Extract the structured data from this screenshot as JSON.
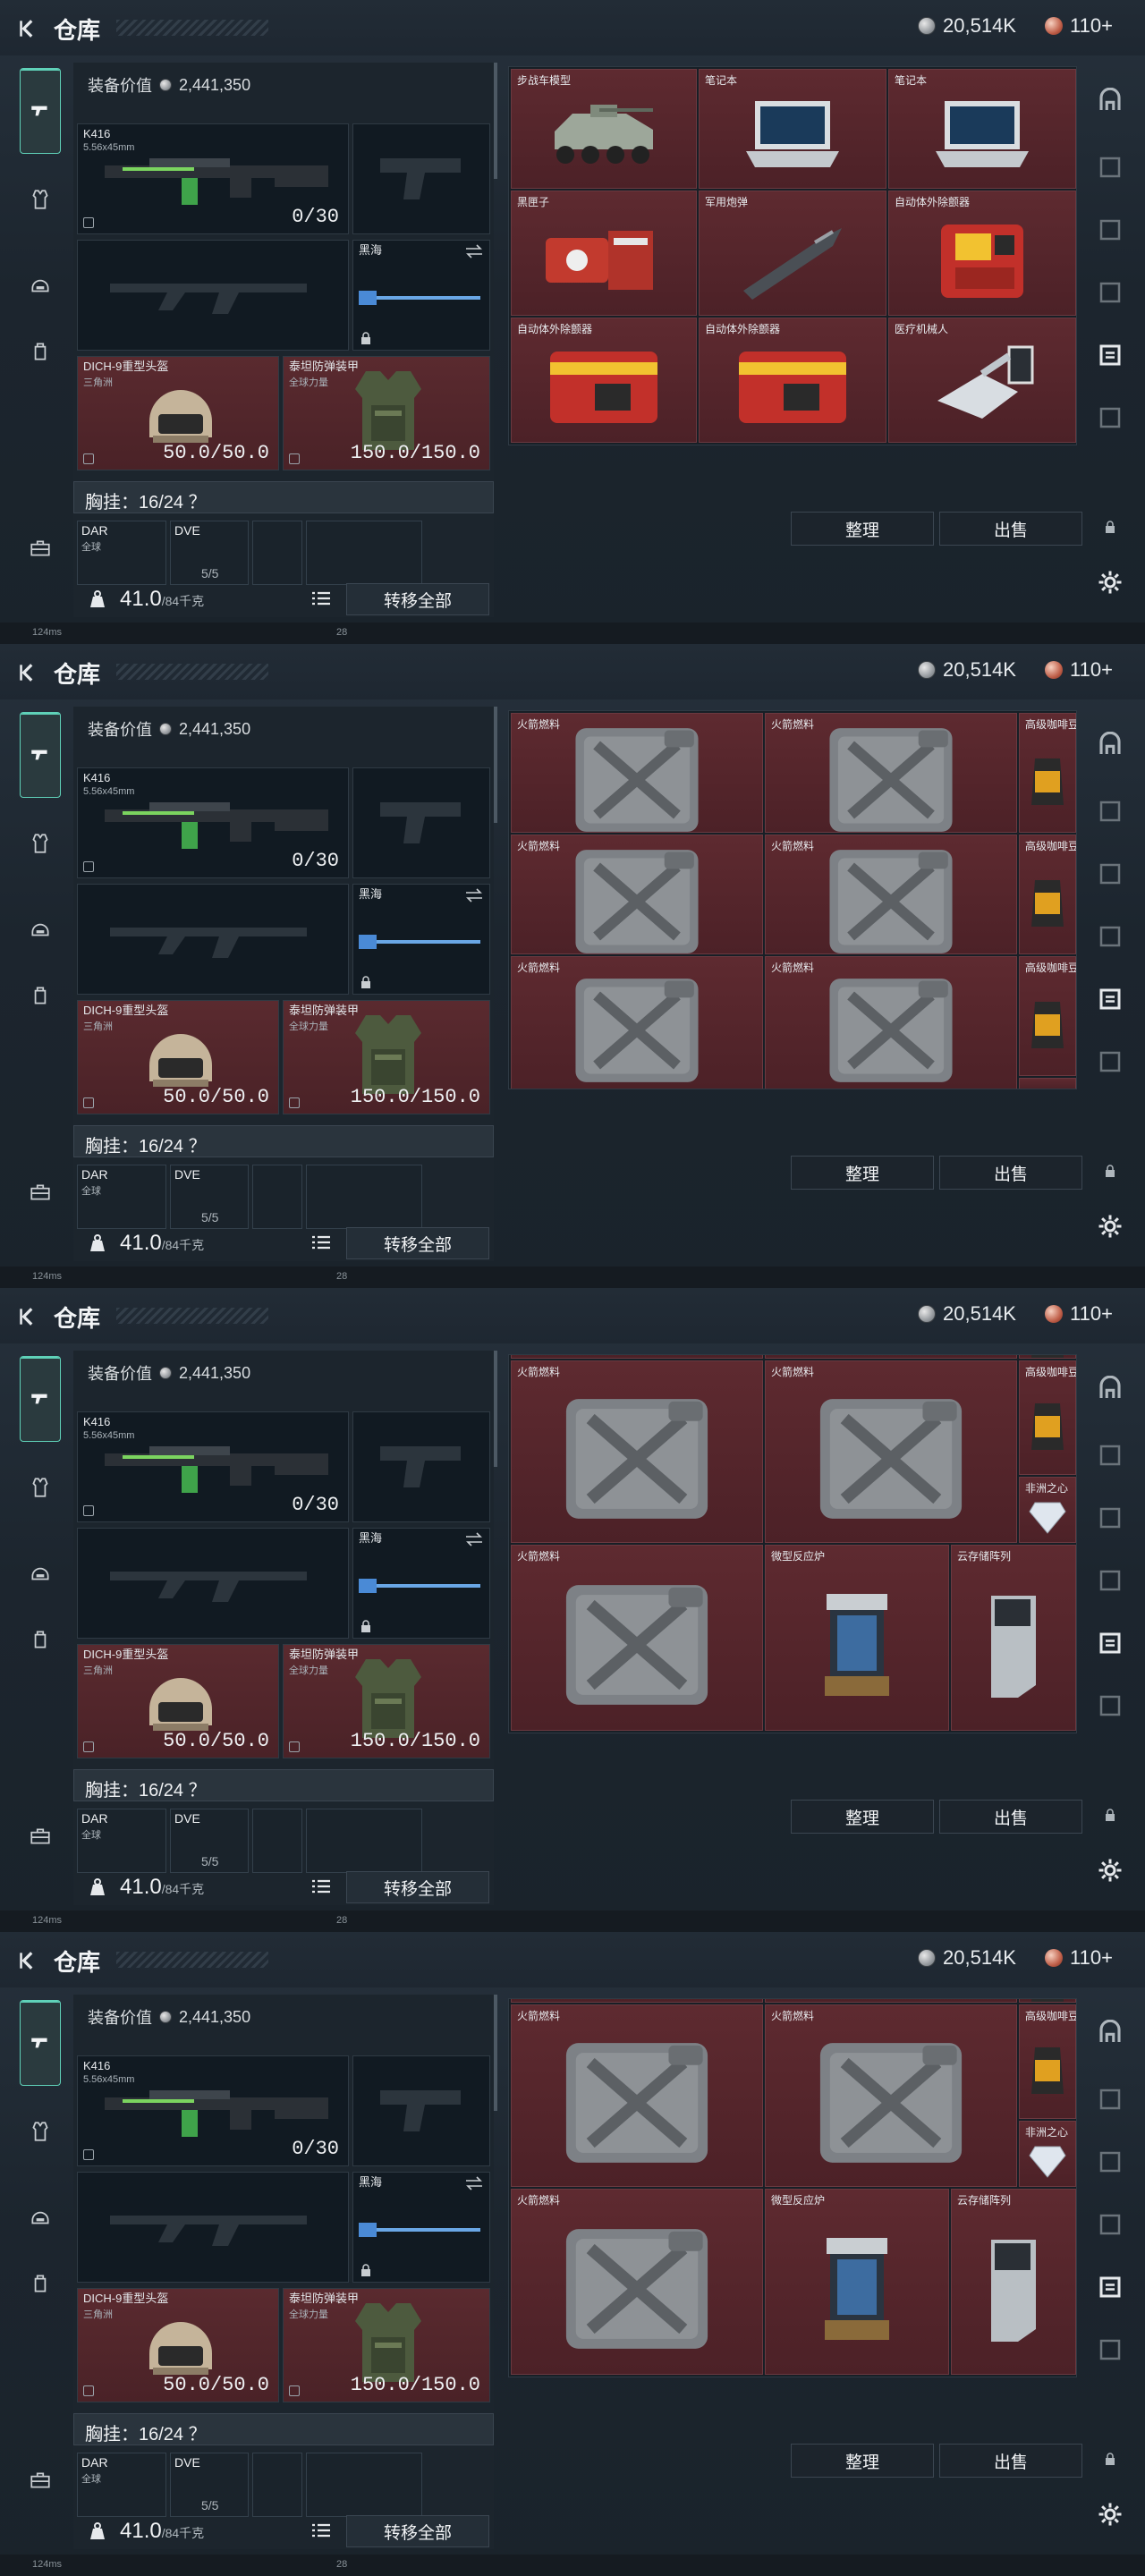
{
  "header": {
    "title": "仓库",
    "coins": "20,514K",
    "gems": "110+"
  },
  "loadout": {
    "equipment_value": "2,441,350",
    "equipment_value_label": "装备价值",
    "primary_name": "K416",
    "primary_caliber": "5.56x45mm",
    "primary_ammo": "0/30",
    "melee_name": "黑海",
    "helmet_name": "DICH-9重型头盔",
    "helmet_brand": "三角洲",
    "helmet_durability": "50.0/50.0",
    "armor_name": "泰坦防弹装甲",
    "armor_brand": "全球力量",
    "armor_durability": "150.0/150.0",
    "vest_label": "胸挂：16/24 ？",
    "pouch1": "DAR",
    "pouch1_sub": "全球",
    "pouch2": "DVE",
    "pouch2_sub": "5/5",
    "weight_main": "41.0",
    "weight_unit": "/84千克",
    "transfer_button": "转移全部"
  },
  "storage_actions": {
    "sort": "整理",
    "sell": "出售"
  },
  "storage_screens": [
    {
      "cells": [
        {
          "name": "步战车模型"
        },
        {
          "name": "笔记本"
        },
        {
          "name": "笔记本"
        },
        {
          "name": "黑匣子"
        },
        {
          "name": "军用炮弹"
        },
        {
          "name": "自动体外除颤器"
        },
        {
          "name": "自动体外除颤器"
        },
        {
          "name": "自动体外除颤器"
        },
        {
          "name": "医疗机械人"
        }
      ]
    },
    {
      "cells": [
        {
          "name": "火箭燃料"
        },
        {
          "name": "火箭燃料"
        },
        {
          "name": "高级咖啡豆"
        },
        {
          "name": "火箭燃料"
        },
        {
          "name": "火箭燃料"
        },
        {
          "name": "高级咖啡豆"
        },
        {
          "name": "高级咖啡豆"
        },
        {
          "name": "火箭燃料"
        },
        {
          "name": "火箭燃料"
        },
        {
          "name": "高级咖啡豆"
        }
      ]
    },
    {
      "cells": [
        {
          "name": "火箭燃料"
        },
        {
          "name": "火箭燃料"
        },
        {
          "name": "高级咖啡豆"
        },
        {
          "name": "非洲之心"
        },
        {
          "name": "火箭燃料"
        },
        {
          "name": "微型反应炉"
        },
        {
          "name": "云存储阵列"
        }
      ]
    },
    {
      "cells": [
        {
          "name": "火箭燃料"
        },
        {
          "name": "火箭燃料"
        },
        {
          "name": "高级咖啡豆"
        },
        {
          "name": "非洲之心"
        },
        {
          "name": "火箭燃料"
        },
        {
          "name": "微型反应炉"
        },
        {
          "name": "云存储阵列"
        }
      ]
    }
  ],
  "status": {
    "ping": "124ms",
    "fps": "28"
  },
  "colors": {
    "accent_teal": "#5fd1b8",
    "item_red": "#5e2a30",
    "panel_dark": "#1c252d"
  }
}
